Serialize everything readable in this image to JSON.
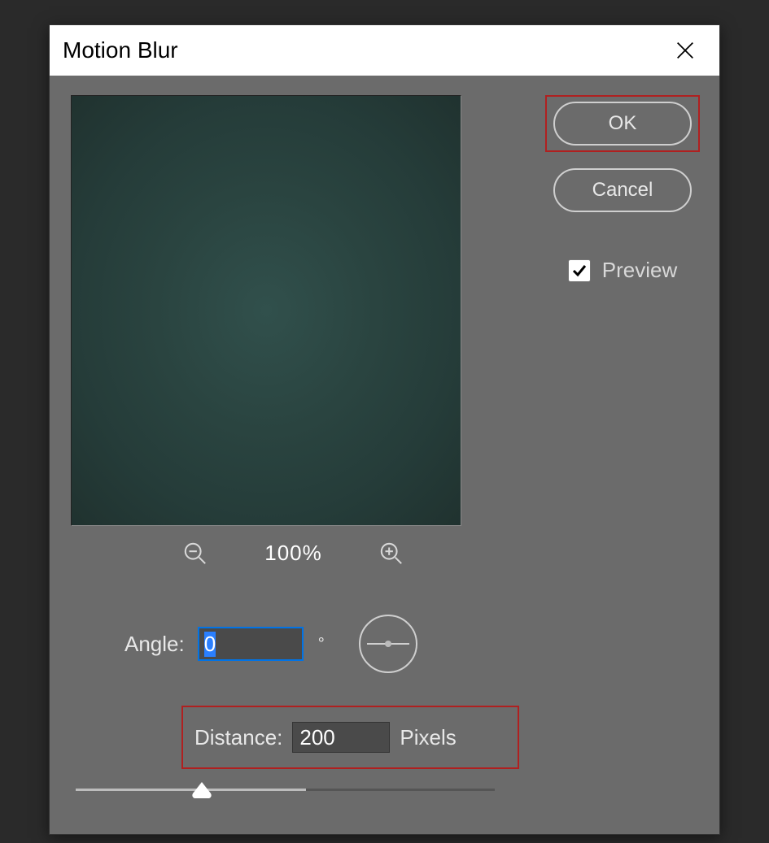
{
  "dialog": {
    "title": "Motion Blur",
    "zoom_level": "100%",
    "buttons": {
      "ok": "OK",
      "cancel": "Cancel"
    },
    "preview_checkbox": {
      "label": "Preview",
      "checked": true
    },
    "angle": {
      "label": "Angle:",
      "value": "0",
      "unit": "°"
    },
    "distance": {
      "label": "Distance:",
      "value": "200",
      "unit": "Pixels"
    },
    "highlights": {
      "ok_color": "#b02020",
      "distance_color": "#b02020"
    },
    "icons": {
      "close": "close-icon",
      "zoom_out": "zoom-out-icon",
      "zoom_in": "zoom-in-icon",
      "angle_dial": "angle-dial-icon",
      "slider_thumb": "slider-thumb-icon",
      "checkmark": "check-icon"
    }
  }
}
